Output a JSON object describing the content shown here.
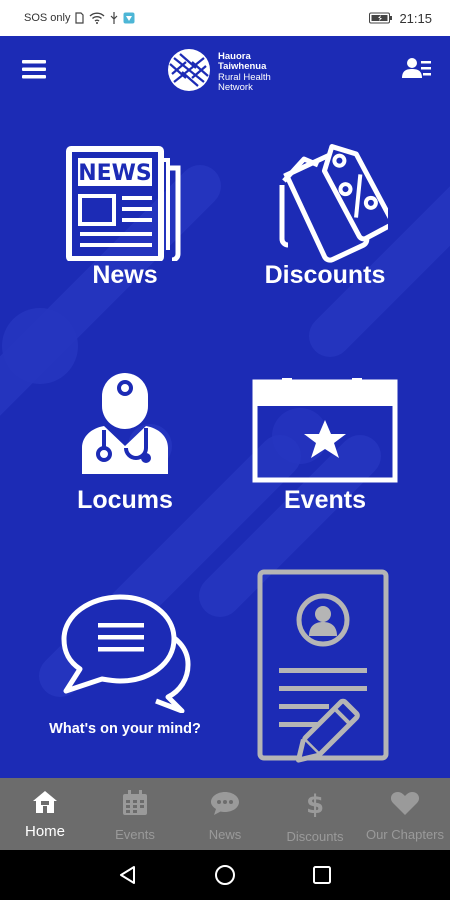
{
  "status_bar": {
    "carrier": "SOS only",
    "time": "21:15"
  },
  "header": {
    "menu_icon": "hamburger-menu-icon",
    "profile_icon": "user-list-icon",
    "logo": {
      "line1": "Hauora",
      "line2": "Taiwhenua",
      "line3": "Rural Health",
      "line4": "Network"
    }
  },
  "tiles": [
    {
      "label": "News",
      "icon": "newspaper-icon"
    },
    {
      "label": "Discounts",
      "icon": "discount-tag-icon"
    },
    {
      "label": "Locums",
      "icon": "doctor-icon"
    },
    {
      "label": "Events",
      "icon": "calendar-star-icon"
    },
    {
      "label": "What's on your mind?",
      "icon": "speech-bubbles-icon"
    },
    {
      "label": "",
      "icon": "profile-document-icon"
    }
  ],
  "newspaper_masthead": "NEWS",
  "bottom_nav": {
    "active": "Home",
    "items": [
      {
        "label": "Home",
        "icon": "home-icon"
      },
      {
        "label": "Events",
        "icon": "calendar-icon"
      },
      {
        "label": "News",
        "icon": "chat-bubble-icon"
      },
      {
        "label": "Discounts",
        "icon": "dollar-icon"
      },
      {
        "label": "Our Chapters",
        "icon": "heart-icon"
      }
    ]
  },
  "colors": {
    "background": "#1c2bb5",
    "nav_bar": "#6c6c6c",
    "nav_inactive": "#9a9a9a",
    "tile_disabled": "#b5b5b5"
  }
}
